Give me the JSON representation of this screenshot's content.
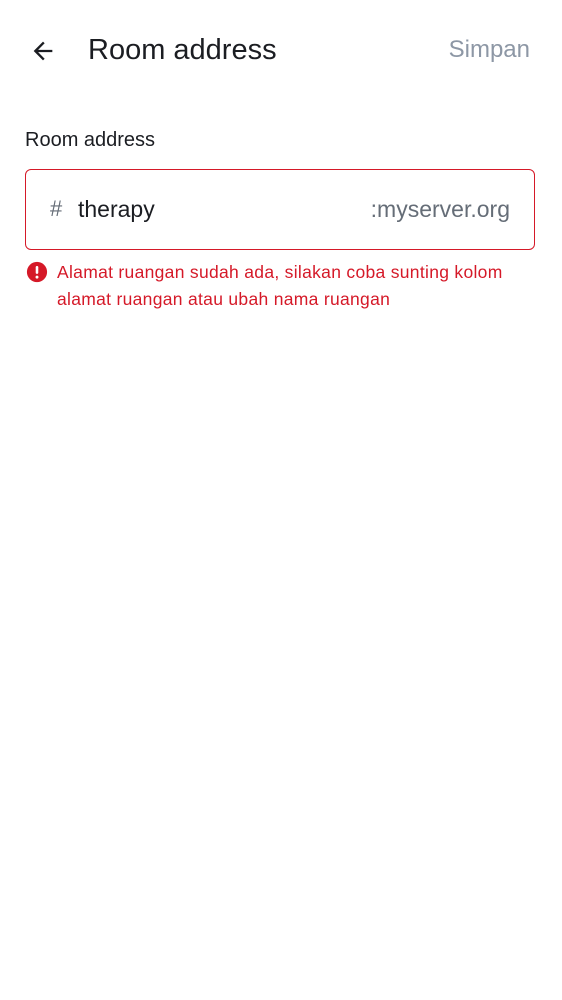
{
  "header": {
    "title": "Room address",
    "save_label": "Simpan",
    "back_icon": "arrow-left-icon"
  },
  "form": {
    "label": "Room address",
    "prefix": "#",
    "value": "therapy",
    "suffix": ":myserver.org",
    "error_icon": "error-circle-icon",
    "error_message": "Alamat ruangan sudah ada, silakan coba sunting kolom alamat ruangan atau ubah nama ruangan"
  },
  "colors": {
    "error": "#d51928",
    "text_primary": "#1b1d22",
    "text_secondary": "#656d77",
    "disabled": "#8d97a5"
  }
}
